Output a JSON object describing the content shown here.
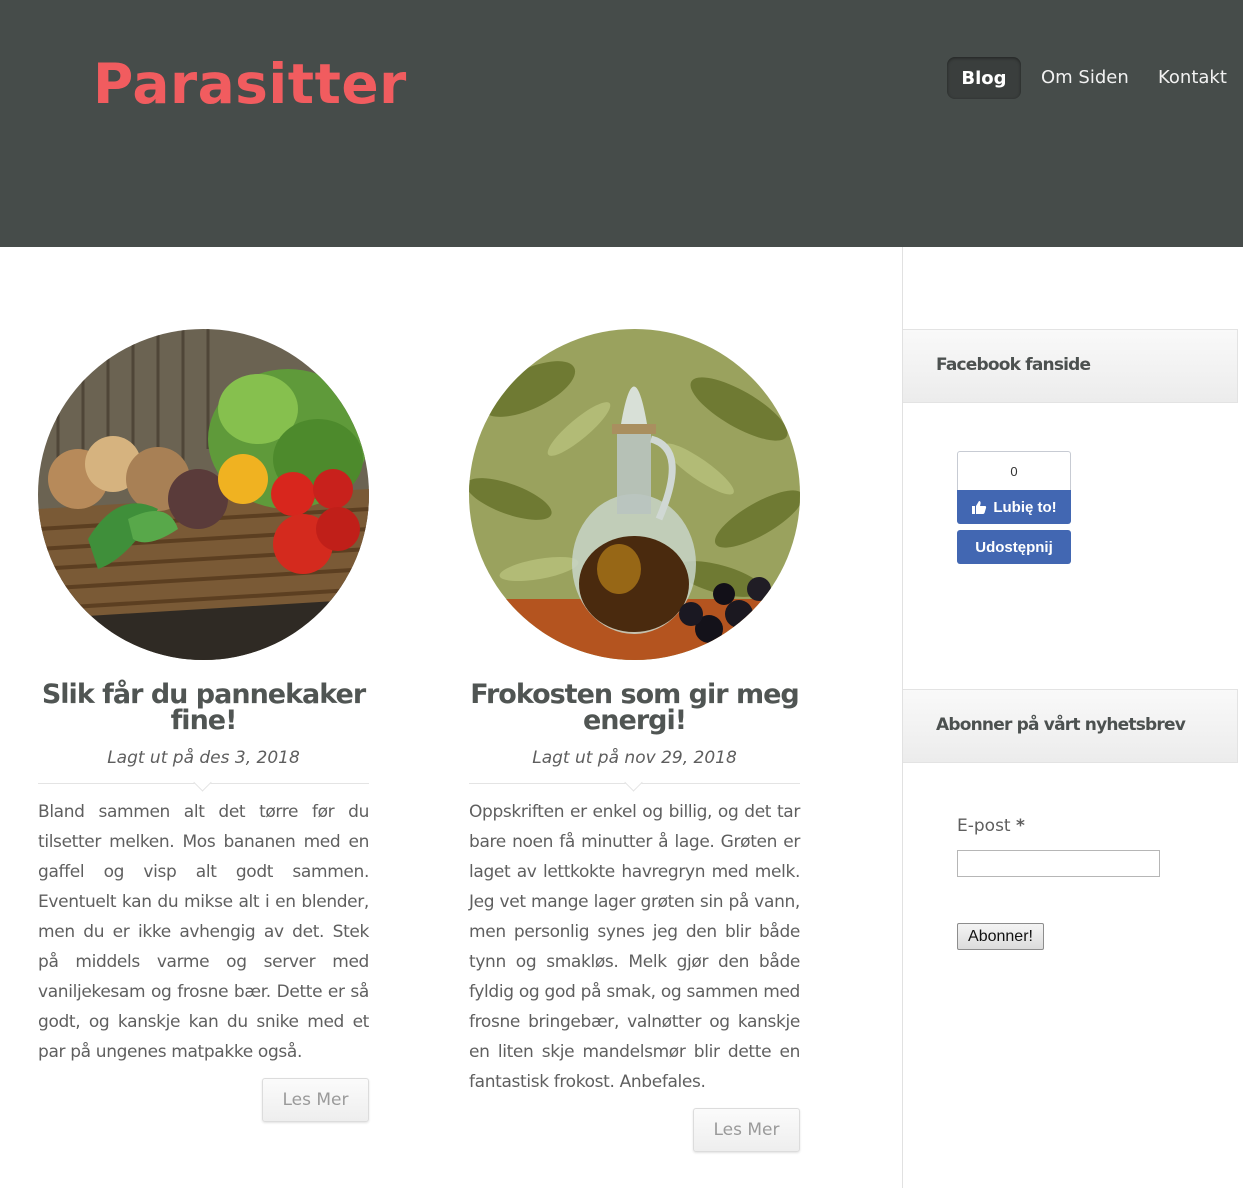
{
  "header": {
    "logo": "Parasitter",
    "nav": [
      {
        "label": "Blog",
        "active": true
      },
      {
        "label": "Om Siden"
      },
      {
        "label": "Kontakt"
      }
    ]
  },
  "posts": [
    {
      "image": "vegetable-basket-image",
      "title": "Slik får du pannekaker fine!",
      "date": "Lagt ut på des 3, 2018",
      "excerpt": "Bland sammen alt det tørre før du tilsetter melken. Mos bananen med en gaffel og visp alt godt sammen. Eventuelt kan du mikse alt i en blender, men du er ikke avhengig av det. Stek på middels varme og server med vaniljekesam og frosne bær. Dette er så godt, og kanskje kan du snike med et par på ungenes matpakke også.",
      "read_more": "Les Mer"
    },
    {
      "image": "olive-oil-carafe-image",
      "title": "Frokosten som gir meg energi!",
      "date": "Lagt ut på nov 29, 2018",
      "excerpt": "Oppskriften er enkel og billig, og det tar bare noen få minutter å lage. Grøten er laget av lettkokte havregryn med melk. Jeg vet mange lager grøten sin på vann, men personlig synes jeg den blir både tynn og smakløs. Melk gjør den både fyldig og god på smak, og sammen med frosne bringebær, valnøtter og kanskje en liten skje mandelsmør blir dette en fantastisk frokost. Anbefales.",
      "read_more": "Les Mer"
    }
  ],
  "sidebar": {
    "facebook": {
      "title": "Facebook fanside",
      "like_count": "0",
      "like_label": "Lubię to!",
      "share_label": "Udostępnij"
    },
    "newsletter": {
      "title": "Abonner på vårt nyhetsbrev",
      "email_label": "E-post",
      "required_mark": "*",
      "email_value": "",
      "submit_label": "Abonner!"
    }
  },
  "colors": {
    "header_bg": "#464c4a",
    "logo": "#f15c5f",
    "facebook_blue": "#4267b2"
  }
}
